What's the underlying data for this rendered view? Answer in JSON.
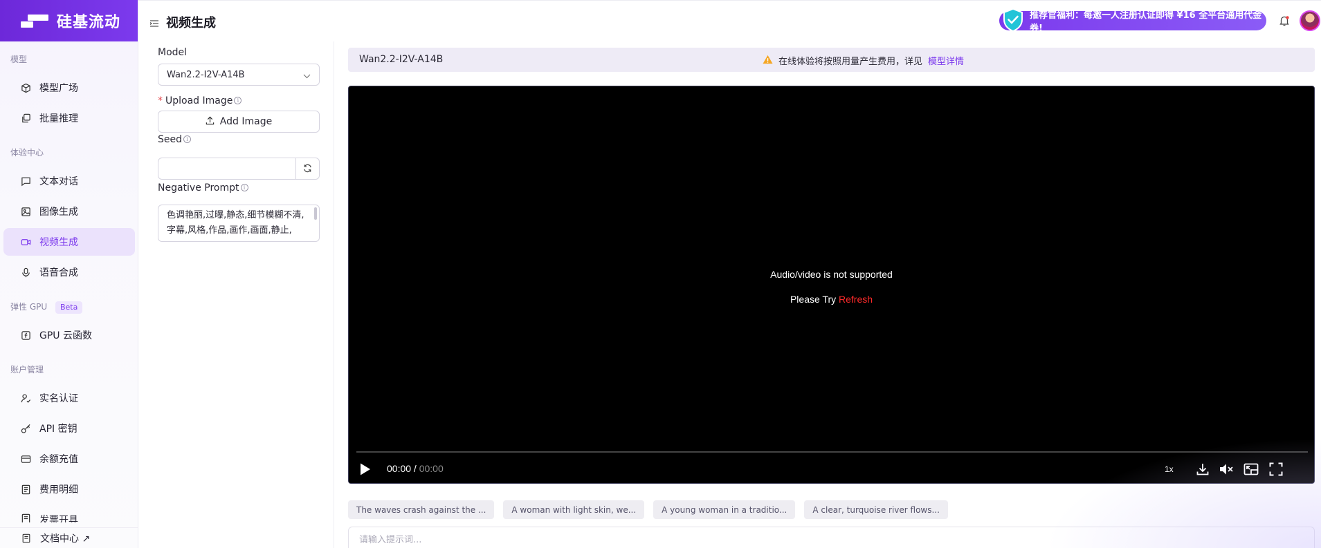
{
  "brand": {
    "name": "硅基流动"
  },
  "header": {
    "title": "视频生成",
    "promo": "推荐官福利：每邀一人注册认证即得 ¥16 全平台通用代金券!"
  },
  "sidebar": {
    "groups": [
      {
        "title": "模型",
        "items": [
          {
            "label": "模型广场",
            "icon": "cube-icon"
          },
          {
            "label": "批量推理",
            "icon": "layers-icon"
          }
        ]
      },
      {
        "title": "体验中心",
        "items": [
          {
            "label": "文本对话",
            "icon": "chat-icon"
          },
          {
            "label": "图像生成",
            "icon": "image-icon"
          },
          {
            "label": "视频生成",
            "icon": "video-icon",
            "active": true
          },
          {
            "label": "语音合成",
            "icon": "mic-icon"
          }
        ]
      },
      {
        "title": "弹性 GPU",
        "badge": "Beta",
        "items": [
          {
            "label": "GPU 云函数",
            "icon": "function-icon"
          }
        ]
      },
      {
        "title": "账户管理",
        "items": [
          {
            "label": "实名认证",
            "icon": "user-check-icon"
          },
          {
            "label": "API 密钥",
            "icon": "key-icon"
          },
          {
            "label": "余额充值",
            "icon": "card-icon"
          },
          {
            "label": "费用明细",
            "icon": "receipt-icon"
          },
          {
            "label": "发票开具",
            "icon": "invoice-icon"
          }
        ]
      }
    ],
    "docs": "文档中心 ↗"
  },
  "form": {
    "model_label": "Model",
    "model_value": "Wan2.2-I2V-A14B",
    "upload_label": "Upload Image",
    "upload_required_mark": "*",
    "add_image": "Add Image",
    "seed_label": "Seed",
    "seed_value": "",
    "negative_label": "Negative Prompt",
    "negative_value": "色调艳丽,过曝,静态,细节模糊不清,字幕,风格,作品,画作,画面,静止,"
  },
  "model_bar": {
    "name": "Wan2.2-I2V-A14B",
    "notice": "在线体验将按照用量产生费用，详见",
    "link": "模型详情"
  },
  "player": {
    "error": "Audio/video is not supported",
    "retry_prefix": "Please Try ",
    "retry_link": "Refresh",
    "current_time": "00:00",
    "separator": " / ",
    "duration": "00:00",
    "speed": "1x",
    "progress": 0
  },
  "suggestions": [
    "The waves crash against the ...",
    "A woman with light skin, we...",
    "A young woman in a traditio...",
    "A clear, turquoise river flows..."
  ],
  "prompt": {
    "placeholder": "请输入提示词..."
  },
  "colors": {
    "accent": "#7c3aed",
    "active_bg": "#ebe2fc",
    "refresh": "#ff2a2a"
  }
}
